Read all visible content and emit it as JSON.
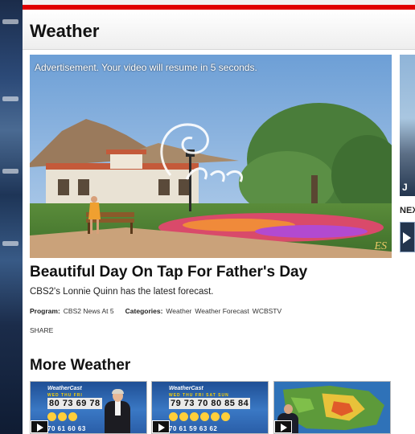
{
  "section": {
    "title": "Weather"
  },
  "video": {
    "ad_notice": "Advertisement.  Your video will resume in 5 seconds.",
    "brand_mark": "ES"
  },
  "sidebar": {
    "next_label": "NEX",
    "thumb_letter": "J"
  },
  "article": {
    "headline": "Beautiful Day On Tap For Father's Day",
    "description": "CBS2's Lonnie Quinn has the latest forecast.",
    "program_label": "Program:",
    "program_value": "CBS2 News At 5",
    "categories_label": "Categories:",
    "categories": [
      "Weather",
      "Weather Forecast",
      "WCBSTV"
    ],
    "share_label": "SHARE"
  },
  "more": {
    "title": "More Weather",
    "items": [
      {
        "title": "WeatherCast",
        "days": "WED THU FRI",
        "temps": "80 73 69 78",
        "lows": "70 61 60 63"
      },
      {
        "title": "WeatherCast",
        "days": "WED THU FRI SAT SUN",
        "temps": "79 73 70 80 85 84",
        "lows": "70 61 59 63 62"
      },
      {
        "title": "",
        "days": "",
        "temps": "",
        "lows": ""
      }
    ]
  },
  "colors": {
    "accent_red": "#e00000",
    "headline": "#111111"
  },
  "icons": {
    "play": "play-icon"
  }
}
